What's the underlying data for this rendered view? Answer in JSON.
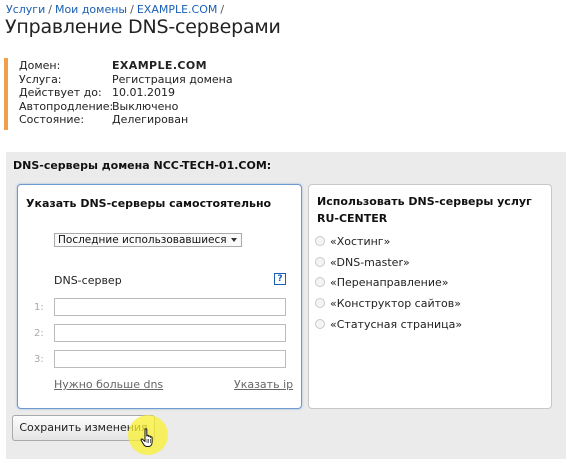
{
  "breadcrumb": {
    "items": [
      "Услуги",
      "Мои домены",
      "EXAMPLE.COM"
    ],
    "separator": "/"
  },
  "page_title": "Управление DNS-серверами",
  "info": {
    "domain_label": "Домен:",
    "domain_value": "EXAMPLE.COM",
    "service_label": "Услуга:",
    "service_value": "Регистрация домена",
    "valid_label": "Действует до:",
    "valid_value": "10.01.2019",
    "autorenew_label": "Автопродление:",
    "autorenew_value": "Выключено",
    "status_label": "Состояние:",
    "status_value": "Делегирован"
  },
  "dns_panel": {
    "title": "DNS-серверы домена NCC-TECH-01.COM:",
    "manual": {
      "title": "Указать DNS-серверы самостоятельно",
      "select_value": "Последние использовавшиеся",
      "dns_label": "DNS-сервер",
      "help": "?",
      "fields": [
        {
          "num": "1:",
          "value": ""
        },
        {
          "num": "2:",
          "value": ""
        },
        {
          "num": "3:",
          "value": ""
        }
      ],
      "more_link": "Нужно больше dns",
      "ip_link": "Указать ip"
    },
    "services": {
      "title": "Использовать DNS-серверы услуг RU-CENTER",
      "options": [
        "«Хостинг»",
        "«DNS-master»",
        "«Перенаправление»",
        "«Конструктор сайтов»",
        "«Статусная страница»"
      ]
    },
    "save_button": "Сохранить изменения"
  },
  "colors": {
    "accent_border": "#f0a04b",
    "link": "#1a5fb4",
    "panel_bg": "#ebebeb",
    "focus_border": "#6d9ad0",
    "cursor_highlight": "#faf032"
  }
}
